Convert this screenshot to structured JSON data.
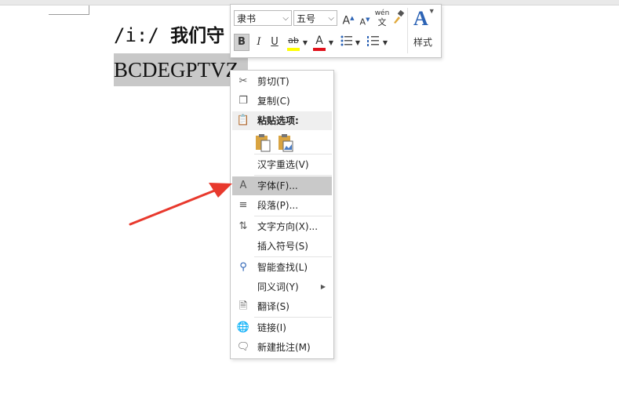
{
  "document": {
    "line1_phonetic": "/i:/",
    "line1_text": "我们守",
    "line2_text": "BCDEGPTVZ"
  },
  "mini_toolbar": {
    "font_name": "隶书",
    "font_size": "五号",
    "grow_font": "A",
    "shrink_font": "A",
    "phonetic_top": "wén",
    "phonetic_bottom": "文",
    "bold": "B",
    "italic": "I",
    "underline": "U",
    "highlight": "ab",
    "font_color": "A",
    "styles_label": "样式"
  },
  "context_menu": {
    "items": [
      {
        "label": "剪切(T)",
        "icon": "scissors-icon"
      },
      {
        "label": "复制(C)",
        "icon": "copy-icon"
      },
      {
        "label": "粘贴选项:",
        "icon": "paste-icon"
      },
      {
        "label": "汉字重选(V)",
        "icon": ""
      },
      {
        "label": "字体(F)...",
        "icon": "font-icon",
        "glyph": "A"
      },
      {
        "label": "段落(P)...",
        "icon": "paragraph-icon"
      },
      {
        "label": "文字方向(X)...",
        "icon": "text-direction-icon"
      },
      {
        "label": "插入符号(S)",
        "icon": ""
      },
      {
        "label": "智能查找(L)",
        "icon": "smart-lookup-icon"
      },
      {
        "label": "同义词(Y)",
        "icon": ""
      },
      {
        "label": "翻译(S)",
        "icon": "translate-icon"
      },
      {
        "label": "链接(I)",
        "icon": "link-icon"
      },
      {
        "label": "新建批注(M)",
        "icon": "new-comment-icon"
      }
    ],
    "highlighted": "字体(F)..."
  },
  "colors": {
    "highlight_yellow": "#ffff00",
    "font_red": "#e0101a",
    "arrow_red": "#e8392d",
    "styles_blue": "#2c63b5",
    "menu_hover": "#c9c9c9"
  }
}
